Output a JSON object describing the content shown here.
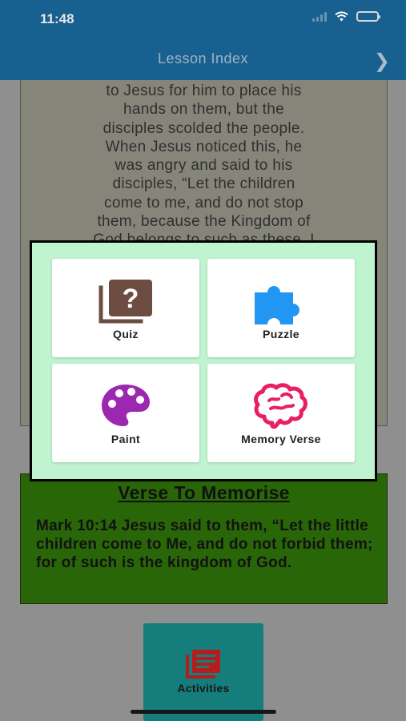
{
  "status_bar": {
    "time": "11:48"
  },
  "nav": {
    "title": "Lesson Index",
    "next_icon": "chevron-right-icon"
  },
  "lesson": {
    "lines": [
      "to Jesus for him to place his",
      "hands on them, but the",
      "disciples scolded the people.",
      "When Jesus noticed this, he",
      "was angry and said to his",
      "disciples, “Let the children",
      "come to me, and do not stop",
      "them, because the Kingdom of",
      "God belongs to such as these. I"
    ]
  },
  "activity_menu": {
    "items": [
      {
        "label": "Quiz",
        "icon": "quiz-icon",
        "color": "#6d4c41"
      },
      {
        "label": "Puzzle",
        "icon": "puzzle-icon",
        "color": "#2196f3"
      },
      {
        "label": "Paint",
        "icon": "palette-icon",
        "color": "#9c27b0"
      },
      {
        "label": "Memory Verse",
        "icon": "brain-icon",
        "color": "#e91e63"
      }
    ]
  },
  "verse": {
    "title": "Verse To Memorise",
    "text": "Mark 10:14 Jesus said to them, “Let the little children come to Me, and do not forbid them; for of such is the kingdom of God."
  },
  "activities_button": {
    "label": "Activities",
    "icon": "activities-icon",
    "color": "#b71c1c"
  },
  "colors": {
    "header": "#17608f",
    "modal_background": "#c0f4d1",
    "verse_background": "#296608",
    "activities_button": "#157e7c"
  }
}
